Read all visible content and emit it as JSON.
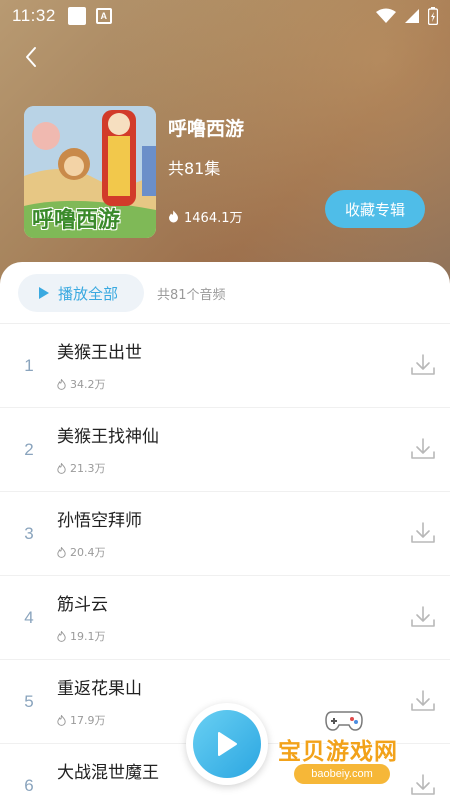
{
  "status_bar": {
    "time": "11:32",
    "notif_letter": "A",
    "icons": [
      "square-notification-icon",
      "a-notification-icon",
      "wifi-icon",
      "signal-icon",
      "battery-charging-icon"
    ]
  },
  "album": {
    "title": "呼噜西游",
    "episode_count": "共81集",
    "plays": "1464.1万",
    "favorite_label": "收藏专辑",
    "cover_text": "呼噜西游"
  },
  "list_header": {
    "play_all_label": "播放全部",
    "total_label": "共81个音频"
  },
  "tracks": [
    {
      "num": "1",
      "title": "美猴王出世",
      "plays": "34.2万"
    },
    {
      "num": "2",
      "title": "美猴王找神仙",
      "plays": "21.3万"
    },
    {
      "num": "3",
      "title": "孙悟空拜师",
      "plays": "20.4万"
    },
    {
      "num": "4",
      "title": "筋斗云",
      "plays": "19.1万"
    },
    {
      "num": "5",
      "title": "重返花果山",
      "plays": "17.9万"
    },
    {
      "num": "6",
      "title": "大战混世魔王",
      "plays": ""
    }
  ],
  "watermark": {
    "text": "宝贝游戏网",
    "url": "baobeiy.com"
  },
  "colors": {
    "accent": "#4fbde8",
    "play_all_text": "#3aa9e0",
    "track_number": "#8aa4bd",
    "watermark": "#f2a21a"
  }
}
